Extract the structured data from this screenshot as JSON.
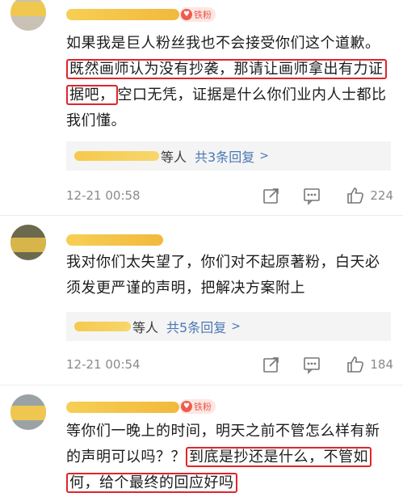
{
  "comments": [
    {
      "fan_badge": "铁粉",
      "text_plain1": "如果我是巨人粉丝我也不会接受你们这个道歉。",
      "text_hl1": "既然画师认为没有抄袭，那请让画师拿出有力证据吧，",
      "text_plain2": "空口无凭，证据是什么你们业内人士都比我们懂。",
      "reply_who": "等人",
      "reply_link": "共3条回复",
      "time": "12-21 00:58",
      "likes": "224"
    },
    {
      "fan_badge": "",
      "text_plain1": "我对你们太失望了，你们对不起原著粉，白天必须发更严谨的声明，把解决方案附上",
      "reply_who": "等人",
      "reply_link": "共5条回复",
      "time": "12-21 00:54",
      "likes": "184"
    },
    {
      "fan_badge": "铁粉",
      "text_plain1": "等你们一晚上的时间，明天之前不管怎么样有新的声明可以吗？？",
      "text_hl1": "到底是抄还是什么，不管如何，给个最终的回应好吗",
      "text_plain2": ""
    }
  ],
  "icons": {
    "share": "share-icon",
    "comment": "comment-icon",
    "like": "like-icon",
    "chevron": "chevron-right-icon",
    "badge_heart": "heart-badge-icon"
  },
  "colors": {
    "highlight_border": "#e0252b",
    "link": "#4a78b5",
    "redaction": "#f5c94e",
    "badge_bg": "#fde7e2",
    "badge_text": "#e8564d"
  }
}
